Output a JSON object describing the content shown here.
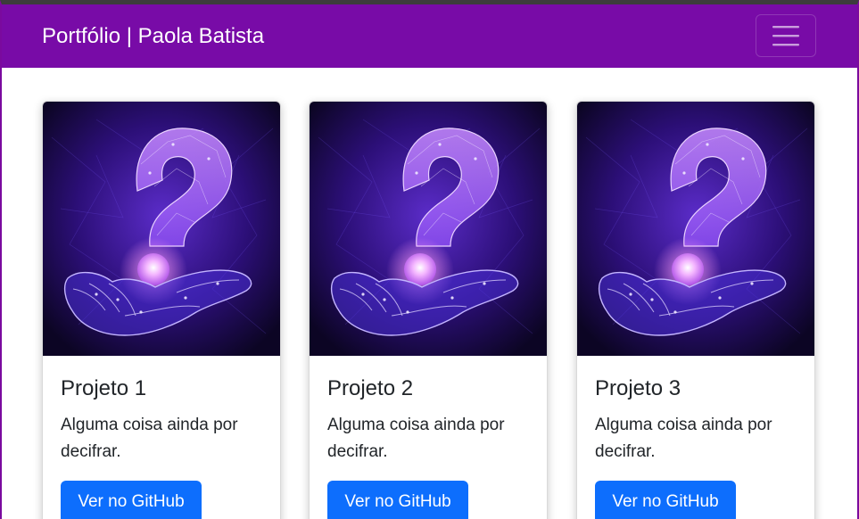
{
  "navbar": {
    "brand": "Portfólio | Paola Batista",
    "toggle_icon": "hamburger-menu-icon",
    "background": "#780ba7"
  },
  "projects": [
    {
      "image": "question-mark-hand-illustration",
      "title": "Projeto 1",
      "text": "Alguma coisa ainda por decifrar.",
      "button_label": "Ver no GitHub"
    },
    {
      "image": "question-mark-hand-illustration",
      "title": "Projeto 2",
      "text": "Alguma coisa ainda por decifrar.",
      "button_label": "Ver no GitHub"
    },
    {
      "image": "question-mark-hand-illustration",
      "title": "Projeto 3",
      "text": "Alguma coisa ainda por decifrar.",
      "button_label": "Ver no GitHub"
    }
  ],
  "colors": {
    "navbar": "#780ba7",
    "button": "#0d6efd",
    "image_background": "#2a1068",
    "glow": "#b57cff"
  }
}
